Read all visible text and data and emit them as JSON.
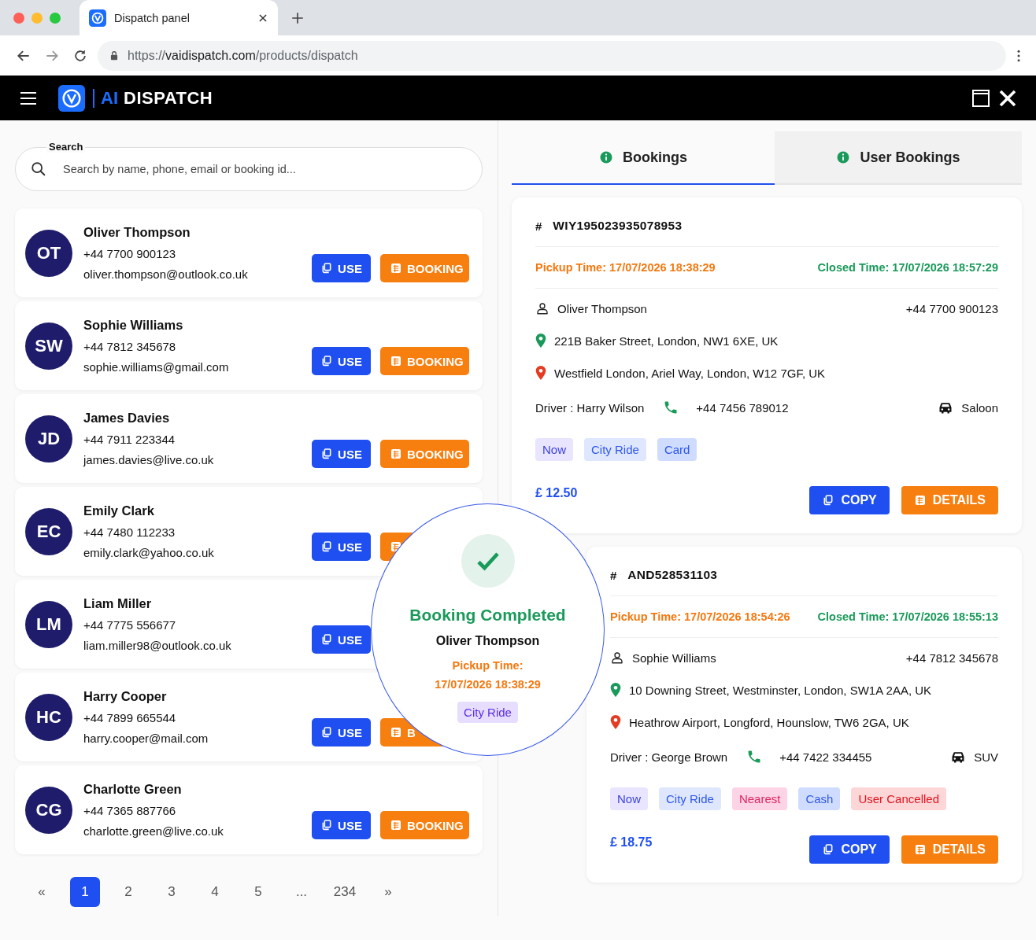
{
  "browser": {
    "tab_title": "Dispatch panel",
    "url_scheme": "https://",
    "url_host": "vaidispatch.com",
    "url_path": "/products/dispatch"
  },
  "app": {
    "brand_ai": "AI",
    "brand_name": "DISPATCH"
  },
  "search": {
    "label": "Search",
    "placeholder": "Search by name, phone, email or booking id..."
  },
  "customers": [
    {
      "initials": "OT",
      "name": "Oliver Thompson",
      "phone": "+44 7700 900123",
      "email": "oliver.thompson@outlook.co.uk",
      "use": "USE",
      "booking": {
        "kind": "labeled",
        "label": "BOOKING"
      }
    },
    {
      "initials": "SW",
      "name": "Sophie Williams",
      "phone": "+44 7812 345678",
      "email": "sophie.williams@gmail.com",
      "use": "USE",
      "booking": {
        "kind": "labeled",
        "label": "BOOKING"
      }
    },
    {
      "initials": "JD",
      "name": "James Davies",
      "phone": "+44 7911 223344",
      "email": "james.davies@live.co.uk",
      "use": "USE",
      "booking": {
        "kind": "labeled",
        "label": "BOOKING"
      }
    },
    {
      "initials": "EC",
      "name": "Emily Clark",
      "phone": "+44 7480 112233",
      "email": "emily.clark@yahoo.co.uk",
      "use": "USE",
      "booking": {
        "kind": "icon_only"
      }
    },
    {
      "initials": "LM",
      "name": "Liam Miller",
      "phone": "+44 7775 556677",
      "email": "liam.miller98@outlook.co.uk",
      "use": "USE"
    },
    {
      "initials": "HC",
      "name": "Harry Cooper",
      "phone": "+44 7899 665544",
      "email": "harry.cooper@mail.com",
      "use": "USE",
      "booking": {
        "kind": "labeled",
        "label": "B"
      }
    },
    {
      "initials": "CG",
      "name": "Charlotte Green",
      "phone": "+44 7365 887766",
      "email": "charlotte.green@live.co.uk",
      "use": "USE",
      "booking": {
        "kind": "labeled",
        "label": "BOOKING"
      }
    }
  ],
  "pagination": [
    {
      "label": "«",
      "selected": false
    },
    {
      "label": "1",
      "selected": true
    },
    {
      "label": "2",
      "selected": false
    },
    {
      "label": "3",
      "selected": false
    },
    {
      "label": "4",
      "selected": false
    },
    {
      "label": "5",
      "selected": false
    },
    {
      "label": "...",
      "selected": false
    },
    {
      "label": "234",
      "selected": false
    },
    {
      "label": "»",
      "selected": false
    }
  ],
  "tabs": [
    {
      "label": "Bookings",
      "selected": true
    },
    {
      "label": "User Bookings",
      "selected": false
    }
  ],
  "bookings": [
    {
      "hash": "#",
      "id": "WIY195023935078953",
      "pickup": "Pickup Time: 17/07/2026 18:38:29",
      "closed": "Closed Time: 17/07/2026 18:57:29",
      "customer": "Oliver Thompson",
      "phone": "+44 7700 900123",
      "from": "221B Baker Street, London, NW1 6XE, UK",
      "to": "Westfield London, Ariel Way, London, W12 7GF, UK",
      "driver": "Driver : Harry Wilson",
      "driver_phone": "+44 7456 789012",
      "vehicle": "Saloon",
      "tags": [
        {
          "label": "Now",
          "kind": "timing"
        },
        {
          "label": "City Ride",
          "kind": "service"
        },
        {
          "label": "Card",
          "kind": "payment"
        }
      ],
      "fare": "£ 12.50",
      "copy": "COPY",
      "details": "DETAILS"
    },
    {
      "hash": "#",
      "id": "AND528531103",
      "pickup": "Pickup Time: 17/07/2026 18:54:26",
      "closed": "Closed Time: 17/07/2026 18:55:13",
      "customer": "Sophie Williams",
      "phone": "+44 7812 345678",
      "from": "10 Downing Street, Westminster, London, SW1A 2AA, UK",
      "to": "Heathrow Airport, Longford, Hounslow, TW6 2GA, UK",
      "driver": "Driver : George Brown",
      "driver_phone": "+44 7422 334455",
      "vehicle": "SUV",
      "tags": [
        {
          "label": "Now",
          "kind": "timing"
        },
        {
          "label": "City Ride",
          "kind": "service"
        },
        {
          "label": "Nearest",
          "kind": "dispatch"
        },
        {
          "label": "Cash",
          "kind": "payment"
        },
        {
          "label": "User Cancelled",
          "kind": "status"
        }
      ],
      "fare": "£ 18.75",
      "copy": "COPY",
      "details": "DETAILS"
    }
  ],
  "popup": {
    "title": "Booking Completed",
    "name": "Oliver Thompson",
    "pickup_label": "Pickup Time:",
    "pickup_time": "17/07/2026 18:38:29",
    "tag": "City Ride"
  }
}
